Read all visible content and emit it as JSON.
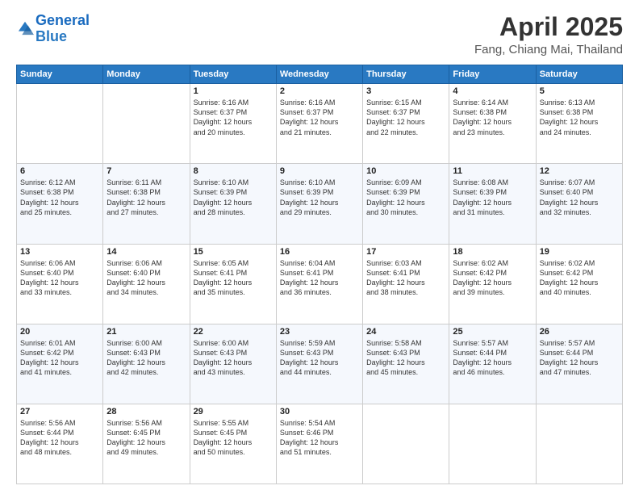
{
  "header": {
    "logo_general": "General",
    "logo_blue": "Blue",
    "month": "April 2025",
    "location": "Fang, Chiang Mai, Thailand"
  },
  "days_of_week": [
    "Sunday",
    "Monday",
    "Tuesday",
    "Wednesday",
    "Thursday",
    "Friday",
    "Saturday"
  ],
  "weeks": [
    [
      {
        "day": "",
        "info": ""
      },
      {
        "day": "",
        "info": ""
      },
      {
        "day": "1",
        "info": "Sunrise: 6:16 AM\nSunset: 6:37 PM\nDaylight: 12 hours\nand 20 minutes."
      },
      {
        "day": "2",
        "info": "Sunrise: 6:16 AM\nSunset: 6:37 PM\nDaylight: 12 hours\nand 21 minutes."
      },
      {
        "day": "3",
        "info": "Sunrise: 6:15 AM\nSunset: 6:37 PM\nDaylight: 12 hours\nand 22 minutes."
      },
      {
        "day": "4",
        "info": "Sunrise: 6:14 AM\nSunset: 6:38 PM\nDaylight: 12 hours\nand 23 minutes."
      },
      {
        "day": "5",
        "info": "Sunrise: 6:13 AM\nSunset: 6:38 PM\nDaylight: 12 hours\nand 24 minutes."
      }
    ],
    [
      {
        "day": "6",
        "info": "Sunrise: 6:12 AM\nSunset: 6:38 PM\nDaylight: 12 hours\nand 25 minutes."
      },
      {
        "day": "7",
        "info": "Sunrise: 6:11 AM\nSunset: 6:38 PM\nDaylight: 12 hours\nand 27 minutes."
      },
      {
        "day": "8",
        "info": "Sunrise: 6:10 AM\nSunset: 6:39 PM\nDaylight: 12 hours\nand 28 minutes."
      },
      {
        "day": "9",
        "info": "Sunrise: 6:10 AM\nSunset: 6:39 PM\nDaylight: 12 hours\nand 29 minutes."
      },
      {
        "day": "10",
        "info": "Sunrise: 6:09 AM\nSunset: 6:39 PM\nDaylight: 12 hours\nand 30 minutes."
      },
      {
        "day": "11",
        "info": "Sunrise: 6:08 AM\nSunset: 6:39 PM\nDaylight: 12 hours\nand 31 minutes."
      },
      {
        "day": "12",
        "info": "Sunrise: 6:07 AM\nSunset: 6:40 PM\nDaylight: 12 hours\nand 32 minutes."
      }
    ],
    [
      {
        "day": "13",
        "info": "Sunrise: 6:06 AM\nSunset: 6:40 PM\nDaylight: 12 hours\nand 33 minutes."
      },
      {
        "day": "14",
        "info": "Sunrise: 6:06 AM\nSunset: 6:40 PM\nDaylight: 12 hours\nand 34 minutes."
      },
      {
        "day": "15",
        "info": "Sunrise: 6:05 AM\nSunset: 6:41 PM\nDaylight: 12 hours\nand 35 minutes."
      },
      {
        "day": "16",
        "info": "Sunrise: 6:04 AM\nSunset: 6:41 PM\nDaylight: 12 hours\nand 36 minutes."
      },
      {
        "day": "17",
        "info": "Sunrise: 6:03 AM\nSunset: 6:41 PM\nDaylight: 12 hours\nand 38 minutes."
      },
      {
        "day": "18",
        "info": "Sunrise: 6:02 AM\nSunset: 6:42 PM\nDaylight: 12 hours\nand 39 minutes."
      },
      {
        "day": "19",
        "info": "Sunrise: 6:02 AM\nSunset: 6:42 PM\nDaylight: 12 hours\nand 40 minutes."
      }
    ],
    [
      {
        "day": "20",
        "info": "Sunrise: 6:01 AM\nSunset: 6:42 PM\nDaylight: 12 hours\nand 41 minutes."
      },
      {
        "day": "21",
        "info": "Sunrise: 6:00 AM\nSunset: 6:43 PM\nDaylight: 12 hours\nand 42 minutes."
      },
      {
        "day": "22",
        "info": "Sunrise: 6:00 AM\nSunset: 6:43 PM\nDaylight: 12 hours\nand 43 minutes."
      },
      {
        "day": "23",
        "info": "Sunrise: 5:59 AM\nSunset: 6:43 PM\nDaylight: 12 hours\nand 44 minutes."
      },
      {
        "day": "24",
        "info": "Sunrise: 5:58 AM\nSunset: 6:43 PM\nDaylight: 12 hours\nand 45 minutes."
      },
      {
        "day": "25",
        "info": "Sunrise: 5:57 AM\nSunset: 6:44 PM\nDaylight: 12 hours\nand 46 minutes."
      },
      {
        "day": "26",
        "info": "Sunrise: 5:57 AM\nSunset: 6:44 PM\nDaylight: 12 hours\nand 47 minutes."
      }
    ],
    [
      {
        "day": "27",
        "info": "Sunrise: 5:56 AM\nSunset: 6:44 PM\nDaylight: 12 hours\nand 48 minutes."
      },
      {
        "day": "28",
        "info": "Sunrise: 5:56 AM\nSunset: 6:45 PM\nDaylight: 12 hours\nand 49 minutes."
      },
      {
        "day": "29",
        "info": "Sunrise: 5:55 AM\nSunset: 6:45 PM\nDaylight: 12 hours\nand 50 minutes."
      },
      {
        "day": "30",
        "info": "Sunrise: 5:54 AM\nSunset: 6:46 PM\nDaylight: 12 hours\nand 51 minutes."
      },
      {
        "day": "",
        "info": ""
      },
      {
        "day": "",
        "info": ""
      },
      {
        "day": "",
        "info": ""
      }
    ]
  ]
}
